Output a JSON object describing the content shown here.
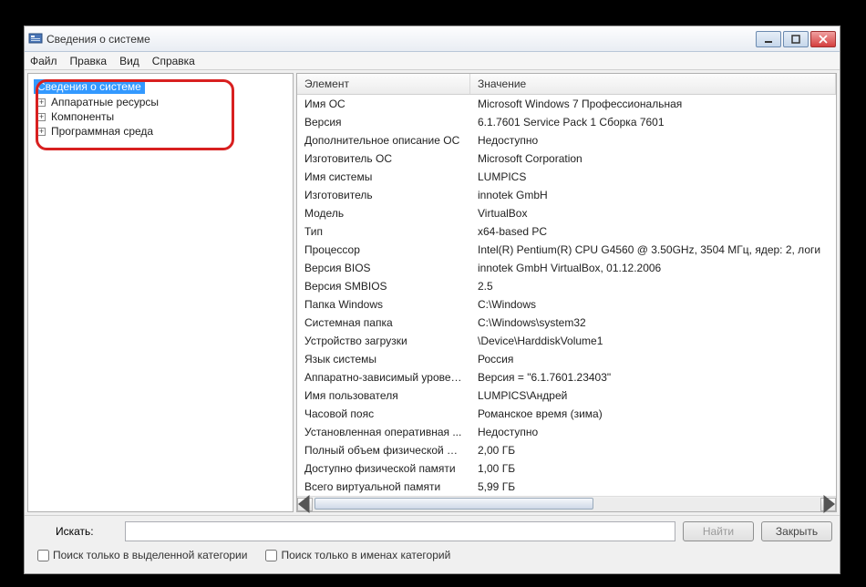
{
  "window": {
    "title": "Сведения о системе"
  },
  "menu": {
    "file": "Файл",
    "edit": "Правка",
    "view": "Вид",
    "help": "Справка"
  },
  "tree": {
    "root": "Сведения о системе",
    "items": [
      {
        "label": "Аппаратные ресурсы"
      },
      {
        "label": "Компоненты"
      },
      {
        "label": "Программная среда"
      }
    ]
  },
  "columns": {
    "element": "Элемент",
    "value": "Значение"
  },
  "rows": [
    {
      "el": "Имя ОС",
      "val": "Microsoft Windows 7 Профессиональная"
    },
    {
      "el": "Версия",
      "val": "6.1.7601 Service Pack 1 Сборка 7601"
    },
    {
      "el": "Дополнительное описание ОС",
      "val": "Недоступно"
    },
    {
      "el": "Изготовитель ОС",
      "val": "Microsoft Corporation"
    },
    {
      "el": "Имя системы",
      "val": "LUMPICS"
    },
    {
      "el": "Изготовитель",
      "val": "innotek GmbH"
    },
    {
      "el": "Модель",
      "val": "VirtualBox"
    },
    {
      "el": "Тип",
      "val": "x64-based PC"
    },
    {
      "el": "Процессор",
      "val": "Intel(R) Pentium(R) CPU G4560 @ 3.50GHz, 3504 МГц, ядер: 2, логи"
    },
    {
      "el": "Версия BIOS",
      "val": "innotek GmbH VirtualBox, 01.12.2006"
    },
    {
      "el": "Версия SMBIOS",
      "val": "2.5"
    },
    {
      "el": "Папка Windows",
      "val": "C:\\Windows"
    },
    {
      "el": "Системная папка",
      "val": "C:\\Windows\\system32"
    },
    {
      "el": "Устройство загрузки",
      "val": "\\Device\\HarddiskVolume1"
    },
    {
      "el": "Язык системы",
      "val": "Россия"
    },
    {
      "el": "Аппаратно-зависимый уровен...",
      "val": "Версия = \"6.1.7601.23403\""
    },
    {
      "el": "Имя пользователя",
      "val": "LUMPICS\\Андрей"
    },
    {
      "el": "Часовой пояс",
      "val": "Романское время (зима)"
    },
    {
      "el": "Установленная оперативная ...",
      "val": "Недоступно"
    },
    {
      "el": "Полный объем физической па...",
      "val": "2,00 ГБ"
    },
    {
      "el": "Доступно физической памяти",
      "val": "1,00 ГБ"
    },
    {
      "el": "Всего виртуальной памяти",
      "val": "5,99 ГБ"
    }
  ],
  "search": {
    "label": "Искать:",
    "find": "Найти",
    "close": "Закрыть",
    "only_cat": "Поиск только в выделенной категории",
    "only_names": "Поиск только в именах категорий"
  }
}
